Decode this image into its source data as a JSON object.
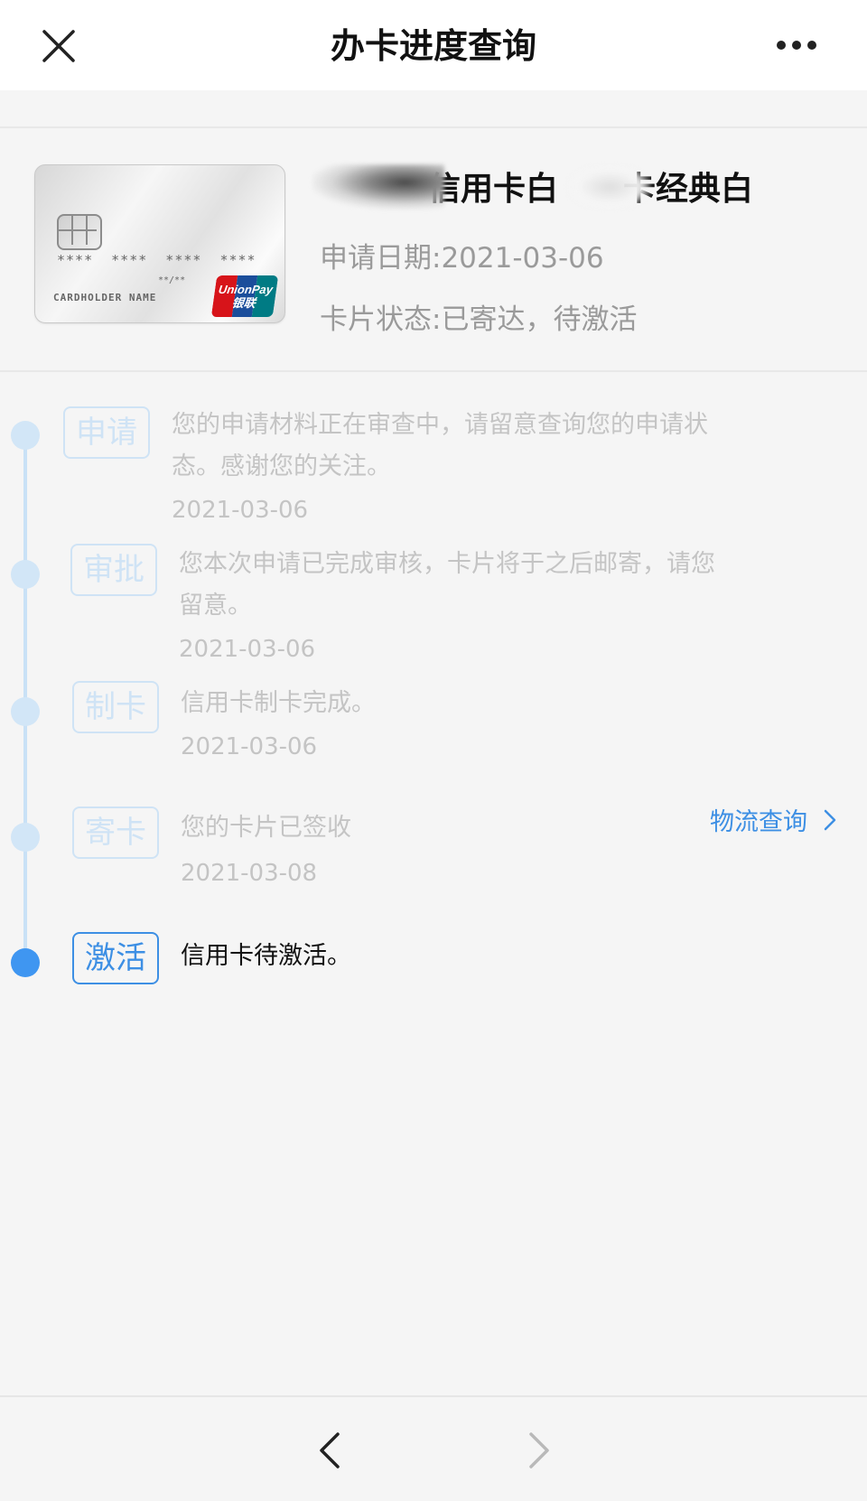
{
  "header": {
    "title": "办卡进度查询",
    "close_icon": "close-icon",
    "more_icon": "more-icon"
  },
  "card": {
    "name": "信用卡白",
    "name_suffix": "卡经典白",
    "apply_date": "申请日期:2021-03-06",
    "status": "卡片状态:已寄达，待激活",
    "thumb": {
      "number_mask": "**** **** **** ****",
      "holder": "CARDHOLDER NAME",
      "valid": "**/**",
      "brand_line1": "UnionPay",
      "brand_line2": "银联"
    }
  },
  "steps": [
    {
      "tag": "申请",
      "text": "您的申请材料正在审查中，请留意查询您的申请状\n态。感谢您的关注。",
      "date": "2021-03-06",
      "active": false
    },
    {
      "tag": "审批",
      "text": "您本次申请已完成审核，卡片将于之后邮寄，请您\n留意。",
      "date": "2021-03-06",
      "active": false
    },
    {
      "tag": "制卡",
      "text": "信用卡制卡完成。",
      "date": "2021-03-06",
      "active": false
    },
    {
      "tag": "寄卡",
      "text": "您的卡片已签收",
      "date": "2021-03-08",
      "active": false
    },
    {
      "tag": "激活",
      "text": "信用卡待激活。",
      "date": "",
      "active": true
    }
  ],
  "logistics": {
    "label": "物流查询"
  },
  "colors": {
    "accent": "#3d8fe4",
    "active_dot": "#3f96f1",
    "inactive": "#cfe3f5",
    "muted_text": "#c4c4c4",
    "background": "#f5f5f5"
  },
  "toolbar": {
    "back_icon": "chevron-left-icon",
    "forward_icon": "chevron-right-icon"
  }
}
